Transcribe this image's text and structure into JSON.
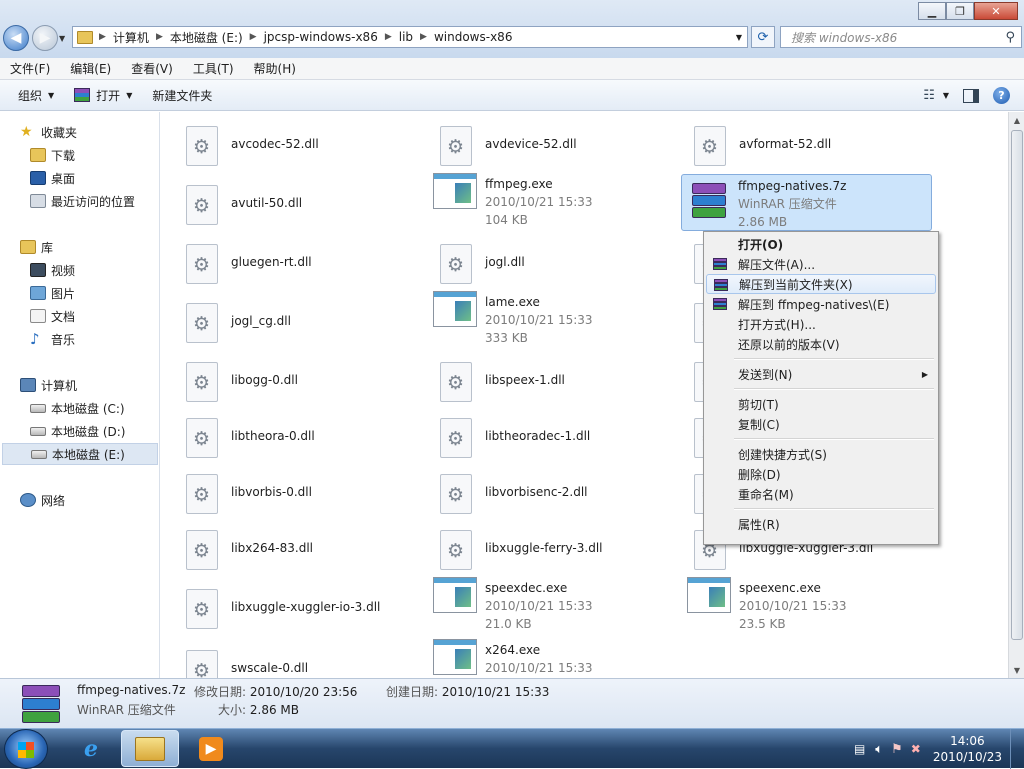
{
  "window": {
    "minimize": "0",
    "maximize": "1",
    "close": "r"
  },
  "address": {
    "crumbs": [
      "计算机",
      "本地磁盘 (E:)",
      "jpcsp-windows-x86",
      "lib",
      "windows-x86"
    ],
    "search_placeholder": "搜索 windows-x86"
  },
  "menu": [
    "文件(F)",
    "编辑(E)",
    "查看(V)",
    "工具(T)",
    "帮助(H)"
  ],
  "toolbar": {
    "organize": "组织",
    "open": "打开",
    "new_folder": "新建文件夹"
  },
  "sidebar": {
    "favorites": "收藏夹",
    "downloads": "下载",
    "desktop": "桌面",
    "recent": "最近访问的位置",
    "libraries": "库",
    "videos": "视频",
    "pictures": "图片",
    "documents": "文档",
    "music": "音乐",
    "computer": "计算机",
    "drive_c": "本地磁盘 (C:)",
    "drive_d": "本地磁盘 (D:)",
    "drive_e": "本地磁盘 (E:)",
    "network": "网络"
  },
  "files": [
    {
      "name": "avcodec-52.dll"
    },
    {
      "name": "avdevice-52.dll"
    },
    {
      "name": "avformat-52.dll"
    },
    {
      "name": "avutil-50.dll"
    },
    {
      "name": "ffmpeg.exe",
      "date": "2010/10/21 15:33",
      "size": "104 KB"
    },
    {
      "name": "ffmpeg-natives.7z",
      "type": "WinRAR 压缩文件",
      "size": "2.86 MB"
    },
    {
      "name": "gluegen-rt.dll"
    },
    {
      "name": "jogl.dll"
    },
    {
      "name": "jogl_cg.dll"
    },
    {
      "name": "lame.exe",
      "date": "2010/10/21 15:33",
      "size": "333 KB"
    },
    {
      "name": "libogg-0.dll"
    },
    {
      "name": "libspeex-1.dll"
    },
    {
      "name": "libtheora-0.dll"
    },
    {
      "name": "libtheoradec-1.dll"
    },
    {
      "name": "libvorbis-0.dll"
    },
    {
      "name": "libvorbisenc-2.dll"
    },
    {
      "name": "libx264-83.dll"
    },
    {
      "name": "libxuggle-ferry-3.dll"
    },
    {
      "name": "libxuggle-xuggler-3.dll"
    },
    {
      "name": "libxuggle-xuggler-io-3.dll"
    },
    {
      "name": "speexdec.exe",
      "date": "2010/10/21 15:33",
      "size": "21.0 KB"
    },
    {
      "name": "speexenc.exe",
      "date": "2010/10/21 15:33",
      "size": "23.5 KB"
    },
    {
      "name": "swscale-0.dll"
    },
    {
      "name": "x264.exe",
      "date": "2010/10/21 15:33"
    }
  ],
  "context_menu": [
    "打开(O)",
    "解压文件(A)...",
    "解压到当前文件夹(X)",
    "解压到 ffmpeg-natives\\(E)",
    "打开方式(H)...",
    "还原以前的版本(V)",
    "发送到(N)",
    "剪切(T)",
    "复制(C)",
    "创建快捷方式(S)",
    "删除(D)",
    "重命名(M)",
    "属性(R)"
  ],
  "details": {
    "name": "ffmpeg-natives.7z",
    "type": "WinRAR 压缩文件",
    "modified_label": "修改日期:",
    "modified": "2010/10/20 23:56",
    "size_label": "大小:",
    "size": "2.86 MB",
    "created_label": "创建日期:",
    "created": "2010/10/21 15:33"
  },
  "taskbar": {
    "time": "14:06",
    "date": "2010/10/23"
  }
}
